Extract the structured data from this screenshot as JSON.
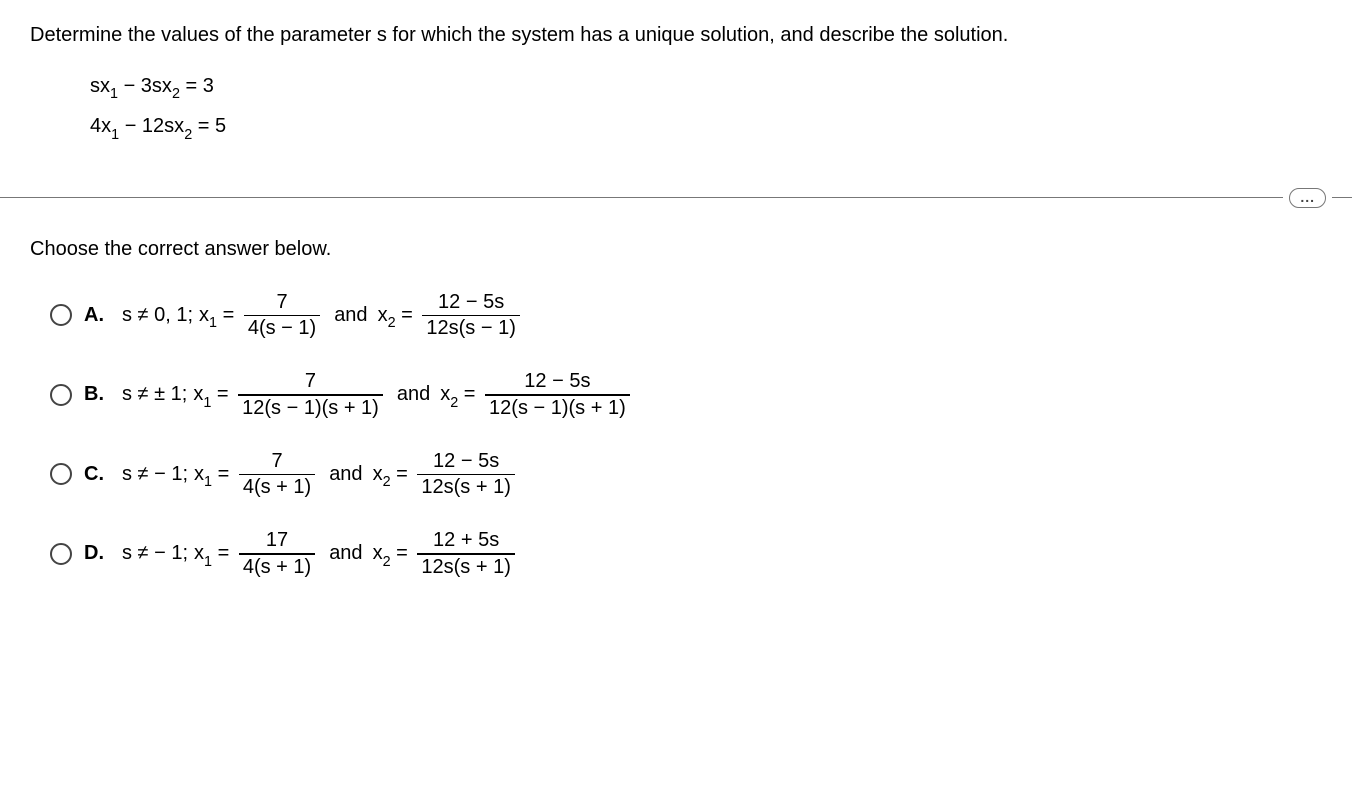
{
  "question": "Determine the values of the parameter s for which the system has a unique solution, and describe the solution.",
  "equations": {
    "eq1_lhs_a": "sx",
    "eq1_lhs_b": " − 3sx",
    "eq1_rhs": " = 3",
    "eq2_lhs_a": "4x",
    "eq2_lhs_b": " − 12sx",
    "eq2_rhs": " = 5",
    "sub1": "1",
    "sub2": "2"
  },
  "divider": {
    "ellipsis": "..."
  },
  "prompt": "Choose the correct answer below.",
  "labels": {
    "A": "A.",
    "B": "B.",
    "C": "C.",
    "D": "D."
  },
  "frag": {
    "x1eq": "x",
    "x1sub": "1",
    "eq": " = ",
    "and": " and ",
    "x2": "x",
    "x2sub": "2"
  },
  "optA": {
    "cond": "s ≠ 0, 1; ",
    "f1n": "7",
    "f1d": "4(s − 1)",
    "f2n": "12 − 5s",
    "f2d": "12s(s − 1)"
  },
  "optB": {
    "cond": "s ≠ ± 1; ",
    "f1n": "7",
    "f1d": "12(s − 1)(s + 1)",
    "f2n": "12 − 5s",
    "f2d": "12(s − 1)(s + 1)"
  },
  "optC": {
    "cond": "s ≠ − 1; ",
    "f1n": "7",
    "f1d": "4(s + 1)",
    "f2n": "12 − 5s",
    "f2d": "12s(s + 1)"
  },
  "optD": {
    "cond": "s ≠ − 1; ",
    "f1n": "17",
    "f1d": "4(s + 1)",
    "f2n": "12 + 5s",
    "f2d": "12s(s + 1)"
  }
}
